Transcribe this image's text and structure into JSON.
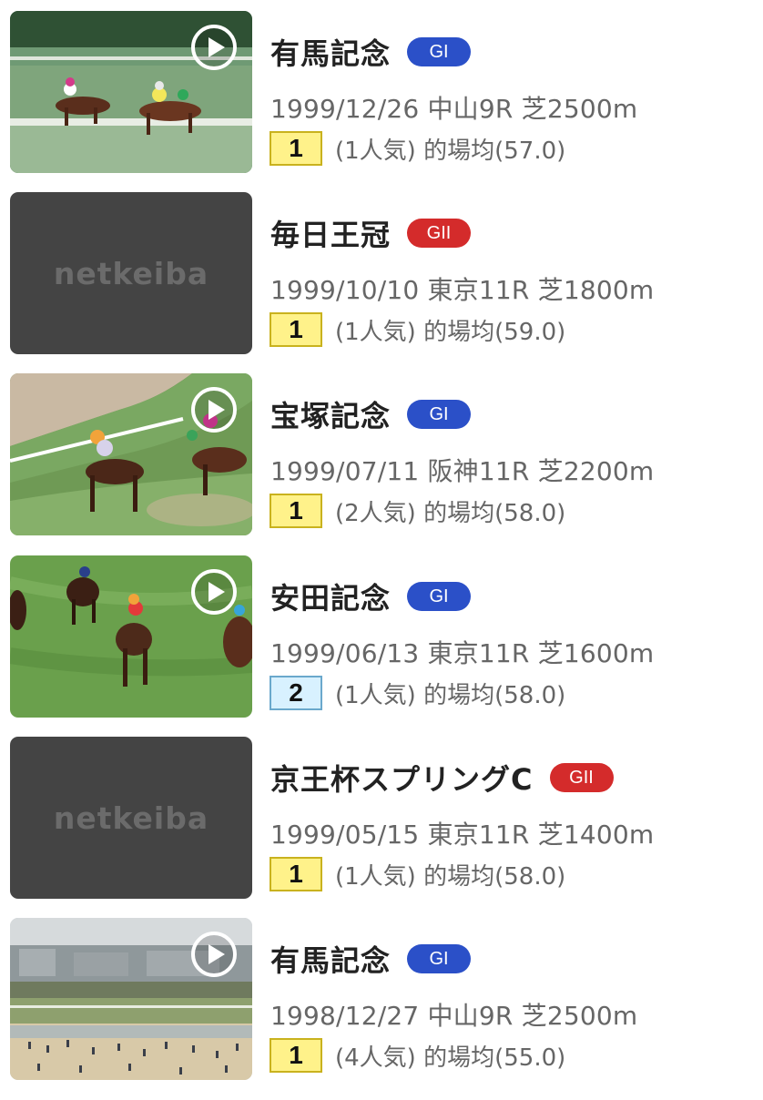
{
  "colors": {
    "grade_g1": "#2b50c8",
    "grade_g2": "#d42b2b",
    "rank_first_bg": "#fff28a",
    "rank_first_border": "#c9b21e",
    "rank_second_bg": "#d8f1ff",
    "rank_second_border": "#6aa8cc",
    "placeholder_bg": "#444444"
  },
  "races": [
    {
      "thumbnail": {
        "type": "video",
        "scene": "finish-line-two-horses",
        "play_icon": "play-circle-icon"
      },
      "name": "有馬記念",
      "grade": "GI",
      "info": "1999/12/26 中山9R 芝2500m",
      "rank": "1",
      "detail": "(1人気) 的場均(57.0)"
    },
    {
      "thumbnail": {
        "type": "placeholder",
        "logo_text": "netkeiba"
      },
      "name": "毎日王冠",
      "grade": "GII",
      "info": "1999/10/10 東京11R 芝1800m",
      "rank": "1",
      "detail": "(1人気) 的場均(59.0)"
    },
    {
      "thumbnail": {
        "type": "video",
        "scene": "turn-on-course",
        "play_icon": "play-circle-icon"
      },
      "name": "宝塚記念",
      "grade": "GI",
      "info": "1999/07/11 阪神11R 芝2200m",
      "rank": "1",
      "detail": "(2人気) 的場均(58.0)"
    },
    {
      "thumbnail": {
        "type": "video",
        "scene": "overhead-turf-stretch",
        "play_icon": "play-circle-icon"
      },
      "name": "安田記念",
      "grade": "GI",
      "info": "1999/06/13 東京11R 芝1600m",
      "rank": "2",
      "detail": "(1人気) 的場均(58.0)"
    },
    {
      "thumbnail": {
        "type": "placeholder",
        "logo_text": "netkeiba"
      },
      "name": "京王杯スプリングC",
      "grade": "GII",
      "info": "1999/05/15 東京11R 芝1400m",
      "rank": "1",
      "detail": "(1人気) 的場均(58.0)"
    },
    {
      "thumbnail": {
        "type": "video",
        "scene": "stadium-wide-shot",
        "play_icon": "play-circle-icon"
      },
      "name": "有馬記念",
      "grade": "GI",
      "info": "1998/12/27 中山9R 芝2500m",
      "rank": "1",
      "detail": "(4人気) 的場均(55.0)"
    }
  ]
}
